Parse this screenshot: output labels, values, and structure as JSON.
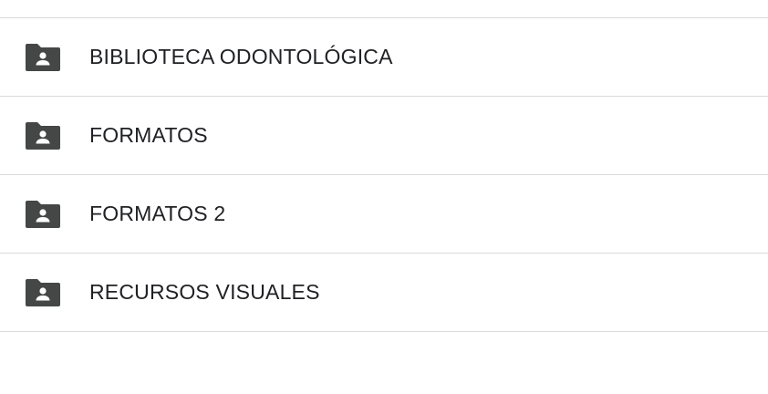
{
  "folders": [
    {
      "label": "BIBLIOTECA ODONTOLÓGICA",
      "icon": "shared-folder-icon"
    },
    {
      "label": "FORMATOS",
      "icon": "shared-folder-icon"
    },
    {
      "label": "FORMATOS 2",
      "icon": "shared-folder-icon"
    },
    {
      "label": "RECURSOS VISUALES",
      "icon": "shared-folder-icon"
    }
  ],
  "colors": {
    "icon": "#444746",
    "text": "#202124",
    "divider": "#dadada"
  }
}
